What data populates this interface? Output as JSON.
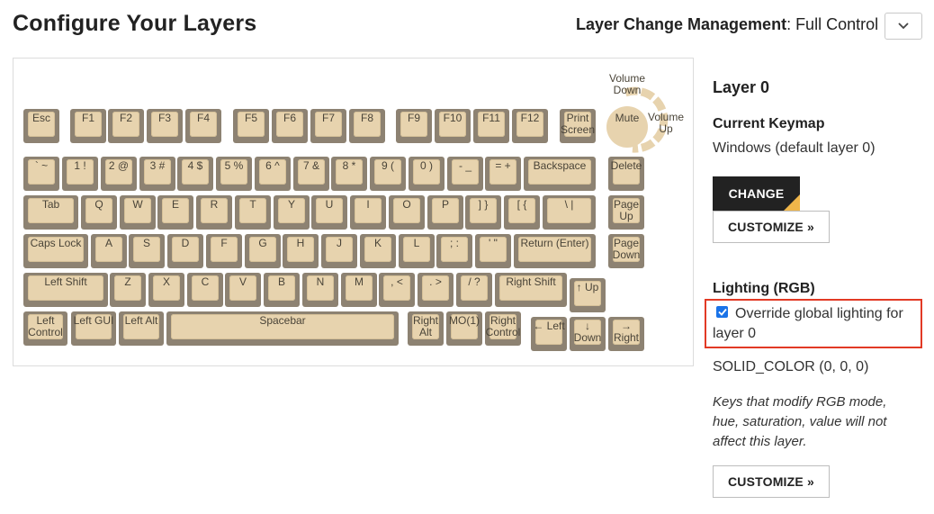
{
  "page_title": "Configure Your Layers",
  "layer_change": {
    "label": "Layer Change Management",
    "value": ": Full Control",
    "dropdown_icon": "chevron-down-icon"
  },
  "keyboard": {
    "keys": [
      {
        "id": "esc",
        "label": "Esc"
      },
      {
        "id": "f1",
        "label": "F1"
      },
      {
        "id": "f2",
        "label": "F2"
      },
      {
        "id": "f3",
        "label": "F3"
      },
      {
        "id": "f4",
        "label": "F4"
      },
      {
        "id": "f5",
        "label": "F5"
      },
      {
        "id": "f6",
        "label": "F6"
      },
      {
        "id": "f7",
        "label": "F7"
      },
      {
        "id": "f8",
        "label": "F8"
      },
      {
        "id": "f9",
        "label": "F9"
      },
      {
        "id": "f10",
        "label": "F10"
      },
      {
        "id": "f11",
        "label": "F11"
      },
      {
        "id": "f12",
        "label": "F12"
      },
      {
        "id": "print-screen",
        "label": "Print\nScreen"
      },
      {
        "id": "grave",
        "label": "` ~"
      },
      {
        "id": "1",
        "label": "1 !"
      },
      {
        "id": "2",
        "label": "2 @"
      },
      {
        "id": "3",
        "label": "3 #"
      },
      {
        "id": "4",
        "label": "4 $"
      },
      {
        "id": "5",
        "label": "5 %"
      },
      {
        "id": "6",
        "label": "6 ^"
      },
      {
        "id": "7",
        "label": "7 &"
      },
      {
        "id": "8",
        "label": "8 *"
      },
      {
        "id": "9",
        "label": "9 ("
      },
      {
        "id": "0",
        "label": "0 )"
      },
      {
        "id": "minus",
        "label": "- _"
      },
      {
        "id": "equal",
        "label": "= +"
      },
      {
        "id": "backspace",
        "label": "Backspace"
      },
      {
        "id": "delete",
        "label": "Delete"
      },
      {
        "id": "tab",
        "label": "Tab"
      },
      {
        "id": "q",
        "label": "Q"
      },
      {
        "id": "w",
        "label": "W"
      },
      {
        "id": "e",
        "label": "E"
      },
      {
        "id": "r",
        "label": "R"
      },
      {
        "id": "t",
        "label": "T"
      },
      {
        "id": "y",
        "label": "Y"
      },
      {
        "id": "u",
        "label": "U"
      },
      {
        "id": "i",
        "label": "I"
      },
      {
        "id": "o",
        "label": "O"
      },
      {
        "id": "p",
        "label": "P"
      },
      {
        "id": "rbracket",
        "label": "] }"
      },
      {
        "id": "lbracket",
        "label": "[ {"
      },
      {
        "id": "backslash",
        "label": "\\ |"
      },
      {
        "id": "page-up",
        "label": "Page\nUp"
      },
      {
        "id": "caps-lock",
        "label": "Caps Lock"
      },
      {
        "id": "a",
        "label": "A"
      },
      {
        "id": "s",
        "label": "S"
      },
      {
        "id": "d",
        "label": "D"
      },
      {
        "id": "f",
        "label": "F"
      },
      {
        "id": "g",
        "label": "G"
      },
      {
        "id": "h",
        "label": "H"
      },
      {
        "id": "j",
        "label": "J"
      },
      {
        "id": "k",
        "label": "K"
      },
      {
        "id": "l",
        "label": "L"
      },
      {
        "id": "semicolon",
        "label": "; :"
      },
      {
        "id": "quote",
        "label": "' \""
      },
      {
        "id": "return",
        "label": "Return (Enter)"
      },
      {
        "id": "page-down",
        "label": "Page\nDown"
      },
      {
        "id": "left-shift",
        "label": "Left Shift"
      },
      {
        "id": "z",
        "label": "Z"
      },
      {
        "id": "x",
        "label": "X"
      },
      {
        "id": "c",
        "label": "C"
      },
      {
        "id": "v",
        "label": "V"
      },
      {
        "id": "b",
        "label": "B"
      },
      {
        "id": "n",
        "label": "N"
      },
      {
        "id": "m",
        "label": "M"
      },
      {
        "id": "comma",
        "label": ", <"
      },
      {
        "id": "period",
        "label": ". >"
      },
      {
        "id": "slash",
        "label": "/ ?"
      },
      {
        "id": "right-shift",
        "label": "Right Shift"
      },
      {
        "id": "up",
        "label": "↑ Up"
      },
      {
        "id": "left-control",
        "label": "Left\nControl"
      },
      {
        "id": "left-gui",
        "label": "Left GUI"
      },
      {
        "id": "left-alt",
        "label": "Left Alt"
      },
      {
        "id": "spacebar",
        "label": "Spacebar"
      },
      {
        "id": "right-alt",
        "label": "Right\nAlt"
      },
      {
        "id": "mo1",
        "label": "MO(1)"
      },
      {
        "id": "right-control",
        "label": "Right\nControl"
      },
      {
        "id": "left",
        "label": "← Left"
      },
      {
        "id": "down",
        "label": "↓\nDown"
      },
      {
        "id": "right",
        "label": "→\nRight"
      }
    ],
    "encoder": {
      "mute": "Mute",
      "volume_down": "Volume\nDown",
      "volume_up": "Volume\nUp"
    },
    "colors": {
      "key_base": "#8d8272",
      "key_cap": "#e7d3ae",
      "knob_arc": "#e7d3ae"
    }
  },
  "sidebar": {
    "layer_title": "Layer 0",
    "keymap_heading": "Current Keymap",
    "keymap_value": "Windows (default layer 0)",
    "change_button": "CHANGE",
    "customize_button": "CUSTOMIZE »",
    "lighting_heading": "Lighting (RGB)",
    "override_checked": true,
    "override_label": "Override global lighting for layer 0",
    "rgb_value": "SOLID_COLOR (0, 0, 0)",
    "rgb_note": "Keys that modify RGB mode, hue, saturation, value will not affect this layer.",
    "customize_button_2": "CUSTOMIZE »",
    "accent_color": "#f0b64a",
    "highlight_color": "#e23a25"
  }
}
